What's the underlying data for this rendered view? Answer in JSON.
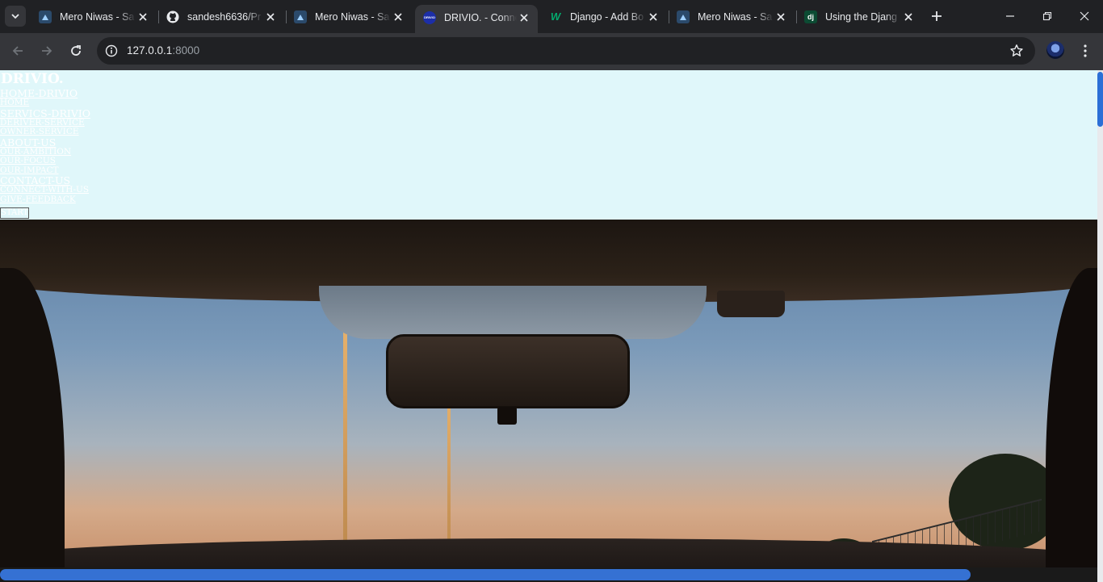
{
  "browser": {
    "tabs": [
      {
        "title": "Mero Niwas - Sa",
        "favicon": "mero-niwas-favicon",
        "active": false
      },
      {
        "title": "sandesh6636/Pr",
        "favicon": "github-icon",
        "active": false
      },
      {
        "title": "Mero Niwas - Sa",
        "favicon": "mero-niwas-favicon",
        "active": false
      },
      {
        "title": "DRIVIO. - Conne",
        "favicon": "drivio-favicon",
        "active": true
      },
      {
        "title": "Django - Add Bo",
        "favicon": "w3schools-icon",
        "active": false
      },
      {
        "title": "Mero Niwas - Sa",
        "favicon": "mero-niwas-favicon",
        "active": false
      },
      {
        "title": "Using the Djang",
        "favicon": "django-icon",
        "active": false
      }
    ],
    "address": {
      "host": "127.0.0.1",
      "port": ":8000"
    },
    "favicon_text": {
      "w3": "W",
      "django": "dj",
      "drivio": "DRIVIO"
    }
  },
  "page": {
    "logo": "DRIVIO.",
    "nav": [
      {
        "label": "HOME-DRIVIO",
        "level": 1
      },
      {
        "label": "HOME",
        "level": 2
      },
      {
        "label": "SERVICS-DRIVIO",
        "level": 1
      },
      {
        "label": "DERIVER-SERVICE",
        "level": 2
      },
      {
        "label": "OWNER-SERVICE",
        "level": 2
      },
      {
        "label": "ABOUT-US",
        "level": 1
      },
      {
        "label": "OUR-AMBITION",
        "level": 2
      },
      {
        "label": "OUR-FOCUS",
        "level": 2
      },
      {
        "label": "OUR-IMPACT",
        "level": 2
      },
      {
        "label": "CONTACT-US",
        "level": 1
      },
      {
        "label": "CONNECT-WITH-US",
        "level": 2
      },
      {
        "label": "GIVE-FEEDBACK",
        "level": 2
      }
    ],
    "start_button": "START",
    "header_bg": "#e0f7fa"
  },
  "colors": {
    "chrome_dark": "#202124",
    "chrome_toolbar": "#35363a",
    "scroll_accent": "#3571d3"
  }
}
